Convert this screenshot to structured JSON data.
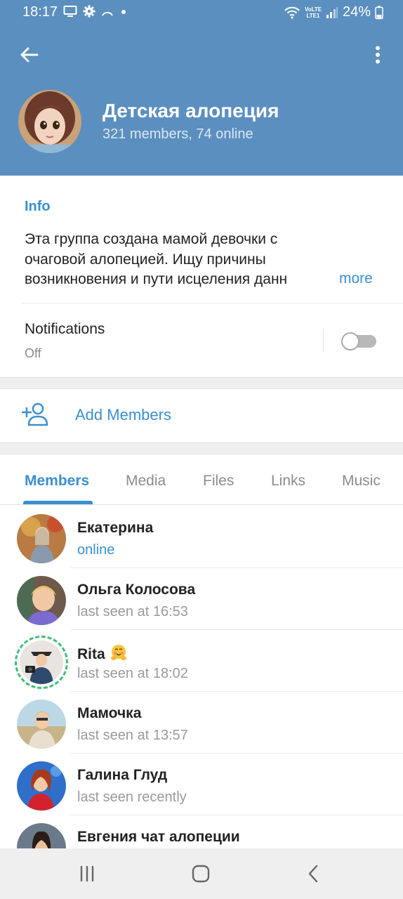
{
  "status_bar": {
    "time": "18:17",
    "battery": "24%",
    "network": "VoLTE LTE1",
    "left_icons": [
      "screen-cast-icon",
      "gear-icon",
      "arc-icon",
      "dot-icon"
    ],
    "right_icons": [
      "wifi-icon",
      "signal-icon",
      "battery-icon"
    ]
  },
  "header": {
    "title": "Детская алопеция",
    "subtitle": "321 members, 74 online",
    "background_color": "#5b8fbf"
  },
  "info": {
    "heading": "Info",
    "description_lines": [
      "Эта группа создана мамой девочки с",
      "очаговой алопецией. Ищу причины",
      "возникновения и пути исцеления данн"
    ],
    "more_label": "more",
    "notifications_label": "Notifications",
    "notifications_value": "Off",
    "notifications_on": false
  },
  "add_members": {
    "label": "Add Members"
  },
  "tabs": [
    {
      "label": "Members",
      "active": true
    },
    {
      "label": "Media",
      "active": false
    },
    {
      "label": "Files",
      "active": false
    },
    {
      "label": "Links",
      "active": false
    },
    {
      "label": "Music",
      "active": false
    }
  ],
  "members": [
    {
      "name": "Екатерина",
      "status": "online",
      "online": true
    },
    {
      "name": "Ольга Колосова",
      "status": "last seen at 16:53",
      "online": false
    },
    {
      "name": "Rita",
      "status": "last seen at 18:02",
      "online": false,
      "has_story": true,
      "emoji": "hugging-face-emoji"
    },
    {
      "name": "Мамочка",
      "status": "last seen at 13:57",
      "online": false
    },
    {
      "name": "Галина Глуд",
      "status": "last seen recently",
      "online": false
    },
    {
      "name": "Евгения чат алопеции",
      "status": "",
      "online": false
    }
  ],
  "accent_color": "#3a8fd1",
  "story_ring_color": "#3fbf7a",
  "navbar": {
    "buttons": [
      "recent-apps-icon",
      "home-icon",
      "back-nav-icon"
    ]
  }
}
